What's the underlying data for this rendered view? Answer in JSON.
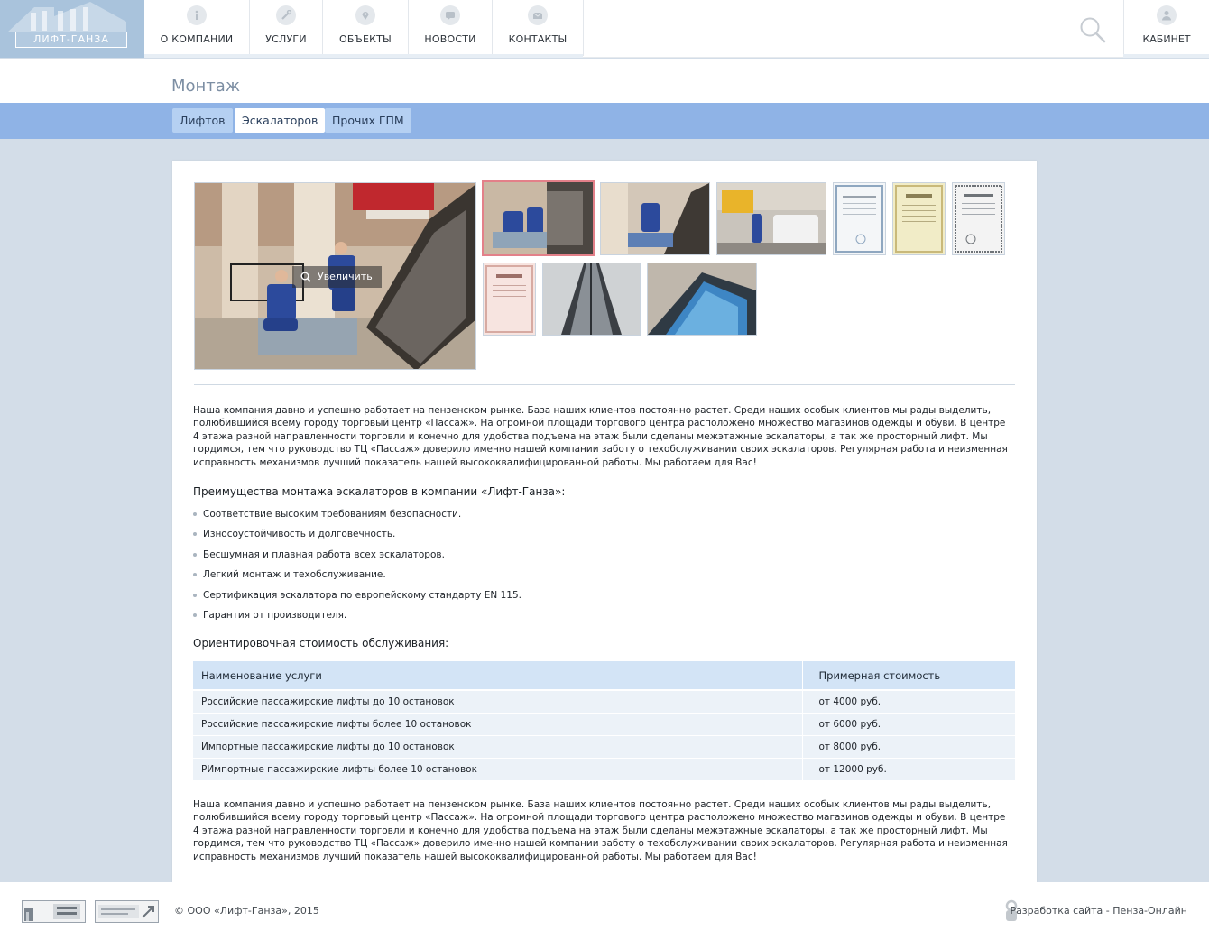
{
  "header": {
    "logo_text": "ЛИФТ-ГАНЗА",
    "nav": [
      {
        "label": "О КОМПАНИИ",
        "icon": "info-icon"
      },
      {
        "label": "УСЛУГИ",
        "icon": "wrench-icon"
      },
      {
        "label": "ОБЪЕКТЫ",
        "icon": "map-pin-icon"
      },
      {
        "label": "НОВОСТИ",
        "icon": "chat-icon"
      },
      {
        "label": "КОНТАКТЫ",
        "icon": "envelope-icon"
      }
    ],
    "cabinet_label": "КАБИНЕТ"
  },
  "page": {
    "title": "Монтаж",
    "tabs": [
      {
        "label": "Лифтов",
        "active": false
      },
      {
        "label": "Эскалаторов",
        "active": true
      },
      {
        "label": "Прочих ГПМ",
        "active": false
      }
    ]
  },
  "gallery": {
    "zoom_label": "Увеличить"
  },
  "content": {
    "intro": "Наша компания давно и успешно работает на пензенском рынке. База наших клиентов постоянно растет. Среди наших особых клиентов мы рады выделить, полюбившийся всему городу торговый центр «Пассаж». На огромной площади торгового центра расположено множество магазинов одежды и обуви. В центре 4 этажа разной направленности торговли и конечно для удобства подъема на этаж были сделаны межэтажные эскалаторы, а так же просторный лифт. Мы гордимся, тем что руководство ТЦ «Пассаж» доверило именно нашей компании заботу о техобслуживании своих эскалаторов. Регулярная работа и неизменная исправность механизмов лучший показатель нашей высококвалифицированной работы. Мы работаем для Вас!",
    "advantages_heading": "Преимущества монтажа эскалаторов  в компании «Лифт-Ганза»:",
    "advantages": [
      "Соответствие высоким требованиям безопасности.",
      "Износоустойчивость и долговечность.",
      "Бесшумная и плавная работа всех эскалаторов.",
      "Легкий монтаж и техобслуживание.",
      "Сертификация эскалатора по европейскому стандарту EN 115.",
      "Гарантия от производителя."
    ],
    "price_heading": "Ориентировочная стоимость обслуживания:",
    "price_table": {
      "headers": [
        "Наименование услуги",
        "Примерная стоимость"
      ],
      "rows": [
        [
          "Российские пассажирские лифты до 10 остановок",
          "от 4000 руб."
        ],
        [
          "Российские пассажирские лифты более 10 остановок",
          "от 6000 руб."
        ],
        [
          "Импортные пассажирские лифты до 10 остановок",
          "от 8000 руб."
        ],
        [
          "РИмпортные пассажирские лифты более 10 остановок",
          "от 12000 руб."
        ]
      ]
    },
    "outro": "Наша компания давно и успешно работает на пензенском рынке. База наших клиентов постоянно растет. Среди наших особых клиентов мы рады выделить, полюбившийся всему городу торговый центр «Пассаж». На огромной площади торгового центра расположено множество магазинов одежды и обуви. В центре 4 этажа разной направленности торговли и конечно для удобства подъема на этаж были сделаны межэтажные эскалаторы, а так же просторный лифт. Мы гордимся, тем что руководство ТЦ «Пассаж» доверило именно нашей компании заботу о техобслуживании своих эскалаторов. Регулярная работа и неизменная исправность механизмов лучший показатель нашей высококвалифицированной работы. Мы работаем для Вас!"
  },
  "footer": {
    "copyright": "© ООО «Лифт-Ганза», 2015",
    "developer": "Разработка сайта - Пенза-Онлайн"
  }
}
